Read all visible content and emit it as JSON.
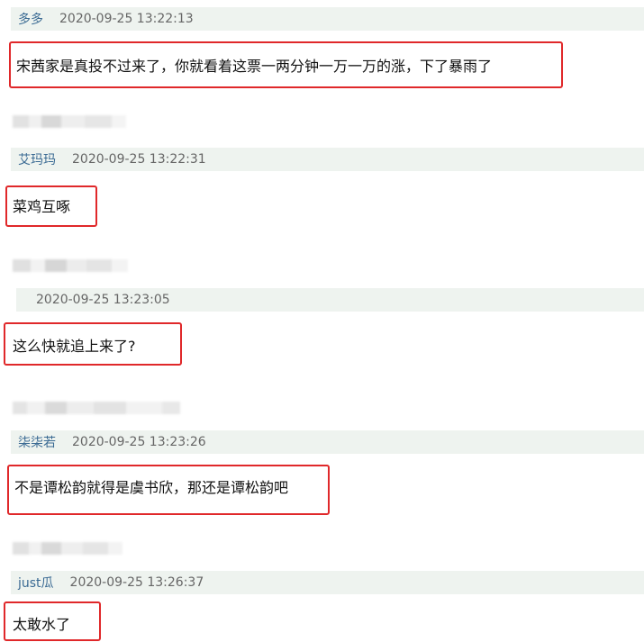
{
  "comments": [
    {
      "username": "多多",
      "timestamp": "2020-09-25 13:22:13",
      "text": "宋茜家是真投不过来了，你就看着这票一两分钟一万一万的涨，下了暴雨了"
    },
    {
      "username": "艾玛玛",
      "timestamp": "2020-09-25 13:22:31",
      "text": "菜鸡互啄"
    },
    {
      "username": "",
      "timestamp": "2020-09-25 13:23:05",
      "text": "这么快就追上来了?"
    },
    {
      "username": "柒柒若",
      "timestamp": "2020-09-25 13:23:26",
      "text": "不是谭松韵就得是虞书欣，那还是谭松韵吧"
    },
    {
      "username": "just瓜",
      "timestamp": "2020-09-25 13:26:37",
      "text": "太敢水了"
    }
  ],
  "colors": {
    "header_bg": "#eef3ef",
    "username": "#3a6a93",
    "timestamp": "#666666",
    "highlight_border": "#e0282a"
  }
}
